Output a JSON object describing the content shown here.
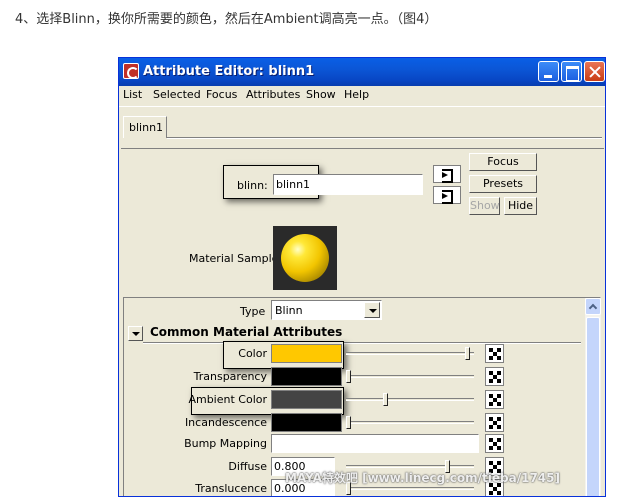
{
  "caption": "4、选择Blinn，换你所需要的颜色，然后在Ambient调高亮一点。（图4）",
  "window": {
    "title": "Attribute Editor: blinn1",
    "menu": [
      "List",
      "Selected",
      "Focus",
      "Attributes",
      "Show",
      "Help"
    ],
    "tab_label": "blinn1",
    "node_label": "blinn:",
    "node_value": "blinn1",
    "buttons": {
      "focus": "Focus",
      "presets": "Presets",
      "show": "Show",
      "hide": "Hide"
    },
    "material_sample_label": "Material Sample",
    "type_label": "Type",
    "type_value": "Blinn",
    "section_title": "Common Material Attributes",
    "attributes": [
      {
        "label": "Color",
        "kind": "color",
        "color": "#FFC800",
        "slider": 0.96,
        "highlight": true
      },
      {
        "label": "Transparency",
        "kind": "color",
        "color": "#000000",
        "slider": 0.0,
        "highlight": false
      },
      {
        "label": "Ambient Color",
        "kind": "color",
        "color": "#444444",
        "slider": 0.3,
        "highlight": true
      },
      {
        "label": "Incandescence",
        "kind": "color",
        "color": "#000000",
        "slider": 0.0,
        "highlight": false
      },
      {
        "label": "Bump Mapping",
        "kind": "text",
        "value": "",
        "highlight": false
      },
      {
        "label": "Diffuse",
        "kind": "number",
        "value": "0.800",
        "slider": 0.8,
        "highlight": false
      },
      {
        "label": "Translucence",
        "kind": "number",
        "value": "0.000",
        "slider": 0.0,
        "highlight": false
      }
    ]
  },
  "watermark": "MAYA特效吧 [www.linecg.com/tieba/1745]"
}
